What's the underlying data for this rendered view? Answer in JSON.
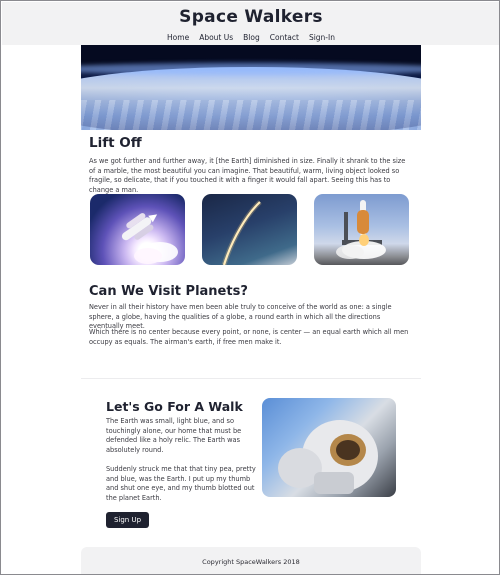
{
  "site": {
    "title": "Space Walkers"
  },
  "nav": [
    {
      "label": "Home"
    },
    {
      "label": "About Us"
    },
    {
      "label": "Blog"
    },
    {
      "label": "Contact"
    },
    {
      "label": "Sign-In"
    }
  ],
  "lift_off": {
    "heading": "Lift Off",
    "body": "As we got further and further away, it [the Earth] diminished in size. Finally it shrank to the size of a marble, the most beautiful you can imagine. That beautiful, warm, living object looked so fragile, so delicate, that if you touched it with a finger it would fall apart. Seeing this has to change a man."
  },
  "planets": {
    "heading": "Can We Visit Planets?",
    "p1": "Never in all their history have men been able truly to conceive of the world as one: a single sphere, a globe, having the qualities of a globe, a round earth in which all the directions eventually meet.",
    "p2": "Which there is no center because every point, or none, is center — an equal earth which all men occupy as equals. The airman's earth, if free men make it."
  },
  "walk": {
    "heading": "Let's Go For A Walk",
    "p1": "The Earth was small, light blue, and so touchingly alone, our home that must be defended like a holy relic. The Earth was absolutely round.",
    "p2": "Suddenly struck me that that tiny pea, pretty and blue, was the Earth. I put up my thumb and shut one eye, and my thumb blotted out the planet Earth.",
    "button": "Sign Up"
  },
  "footer": {
    "text": "Copyright SpaceWalkers 2018"
  }
}
